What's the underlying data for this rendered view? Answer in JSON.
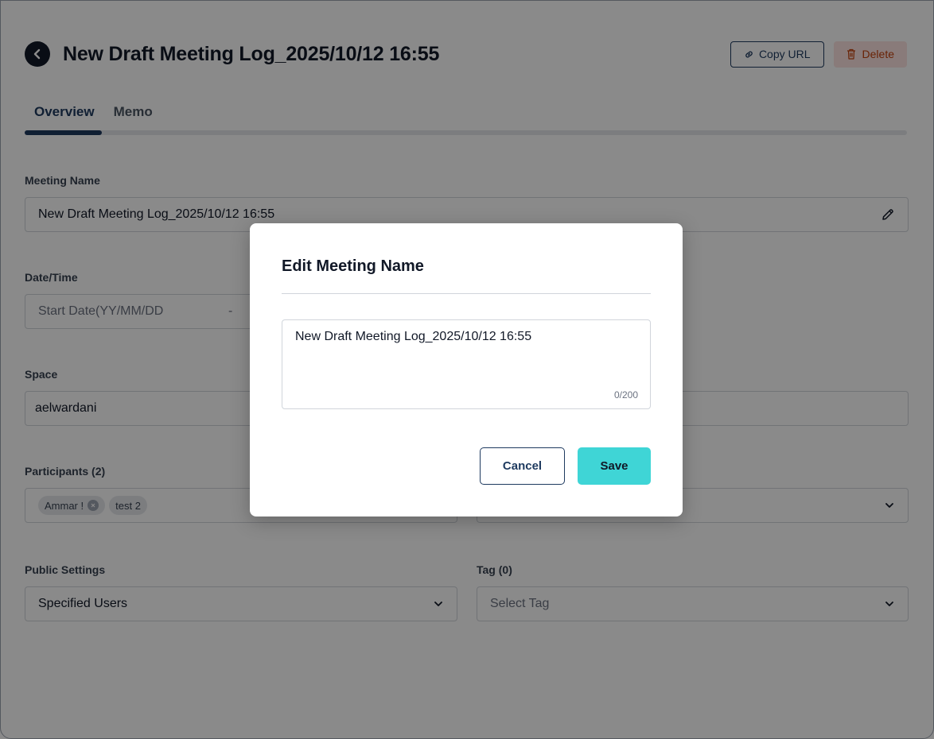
{
  "header": {
    "title": "New Draft Meeting Log_2025/10/12 16:55",
    "copy_url_label": "Copy URL",
    "delete_label": "Delete"
  },
  "tabs": [
    {
      "label": "Overview",
      "active": true
    },
    {
      "label": "Memo",
      "active": false
    }
  ],
  "form": {
    "meeting_name": {
      "label": "Meeting Name",
      "value": "New Draft Meeting Log_2025/10/12 16:55"
    },
    "datetime": {
      "label": "Date/Time",
      "start_placeholder": "Start Date(YY/MM/DD",
      "separator": "-"
    },
    "space": {
      "label": "Space",
      "value": "aelwardani"
    },
    "participants": {
      "label": "Participants (2)",
      "chips": [
        "Ammar !",
        "test 2"
      ]
    },
    "public_settings": {
      "label": "Public Settings",
      "value": "Specified Users"
    },
    "tag": {
      "label": "Tag (0)",
      "placeholder": "Select Tag"
    }
  },
  "modal": {
    "title": "Edit Meeting Name",
    "value": "New Draft Meeting Log_2025/10/12 16:55",
    "char_count": "0/200",
    "cancel_label": "Cancel",
    "save_label": "Save"
  },
  "colors": {
    "primary": "#1e3a5f",
    "accent": "#3fd5d6",
    "danger_bg": "#fde4e1",
    "danger_text": "#c2410c"
  }
}
